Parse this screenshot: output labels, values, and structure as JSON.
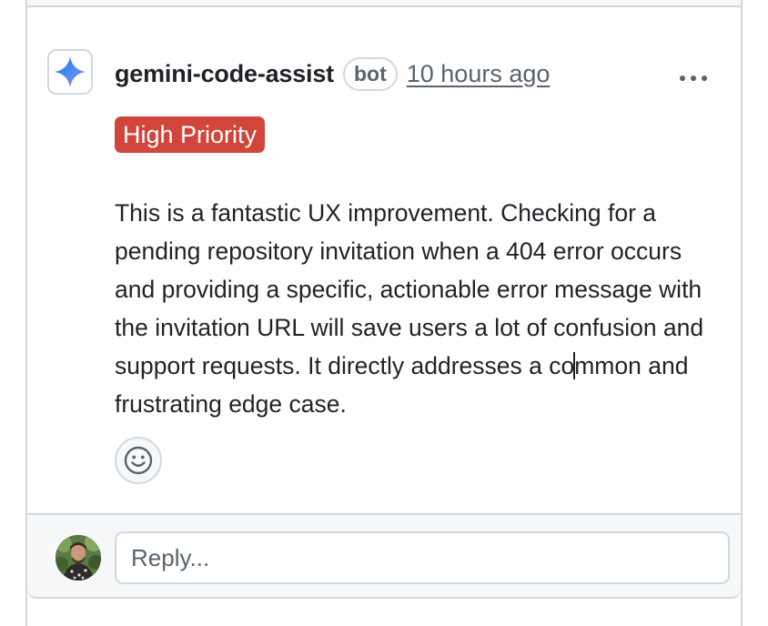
{
  "comment": {
    "author": "gemini-code-assist",
    "badge": "bot",
    "timestamp": "10 hours ago",
    "label": "High Priority",
    "label_color": "#d1453b",
    "body_before_caret": "This is a fantastic UX improvement. Checking for a pending repository invitation when a 404 error occurs and providing a specific, actionable error message with the invitation URL will save users a lot of confusion and support requests. It directly addresses a co",
    "body_after_caret": "mmon and frustrating edge case.",
    "author_icon": "gemini-sparkle-icon",
    "menu_icon": "kebab-menu-icon",
    "reaction_icon": "smiley-icon"
  },
  "reply": {
    "placeholder": "Reply...",
    "avatar_icon": "user-avatar"
  }
}
